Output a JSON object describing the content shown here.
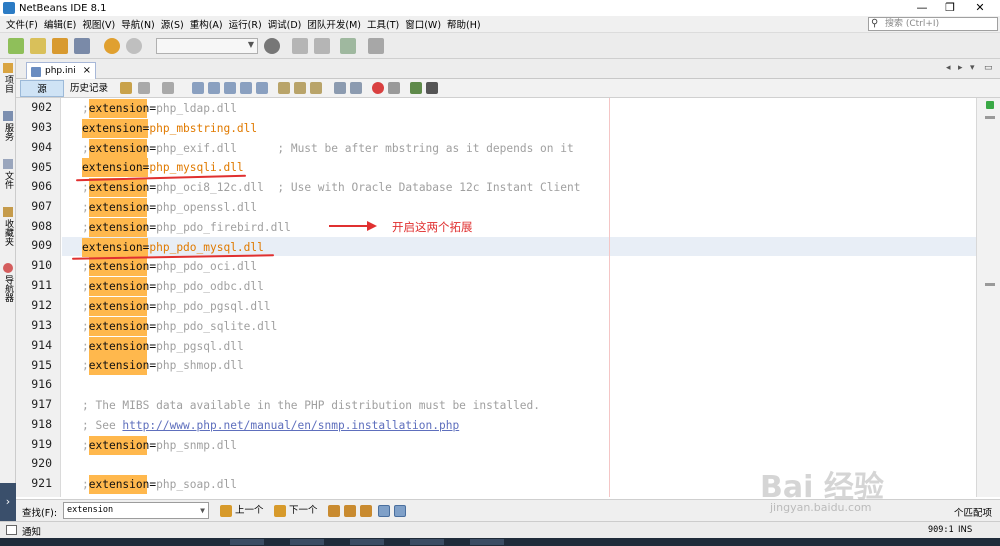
{
  "window": {
    "title": "NetBeans IDE 8.1",
    "minimize": "—",
    "restore": "❐",
    "close": "✕"
  },
  "menu": [
    "文件(F)",
    "编辑(E)",
    "视图(V)",
    "导航(N)",
    "源(S)",
    "重构(A)",
    "运行(R)",
    "调试(D)",
    "团队开发(M)",
    "工具(T)",
    "窗口(W)",
    "帮助(H)"
  ],
  "search": {
    "placeholder": "搜索 (Ctrl+I)",
    "icon": "magnifier-icon"
  },
  "side_tabs": [
    "项目",
    "服务",
    "文件",
    "收藏夹",
    "导航器"
  ],
  "editor_tab": {
    "name": "php.ini",
    "close": "×"
  },
  "editor_toolbar": {
    "source": "源",
    "history": "历史记录"
  },
  "lines": [
    {
      "n": "902",
      "pre": ";",
      "kw": "extension",
      "val": "php_ldap.dll",
      "cmt": "",
      "on": false
    },
    {
      "n": "903",
      "pre": "",
      "kw": "extension",
      "val": "php_mbstring.dll",
      "cmt": "",
      "on": true
    },
    {
      "n": "904",
      "pre": ";",
      "kw": "extension",
      "val": "php_exif.dll",
      "cmt": "      ; Must be after mbstring as it depends on it",
      "on": false
    },
    {
      "n": "905",
      "pre": "",
      "kw": "extension",
      "val": "php_mysqli.dll",
      "cmt": "",
      "on": true
    },
    {
      "n": "906",
      "pre": ";",
      "kw": "extension",
      "val": "php_oci8_12c.dll",
      "cmt": "  ; Use with Oracle Database 12c Instant Client",
      "on": false
    },
    {
      "n": "907",
      "pre": ";",
      "kw": "extension",
      "val": "php_openssl.dll",
      "cmt": "",
      "on": false
    },
    {
      "n": "908",
      "pre": ";",
      "kw": "extension",
      "val": "php_pdo_firebird.dll",
      "cmt": "",
      "on": false
    },
    {
      "n": "909",
      "pre": "",
      "kw": "extension",
      "val": "php_pdo_mysql.dll",
      "cmt": "",
      "on": true
    },
    {
      "n": "910",
      "pre": ";",
      "kw": "extension",
      "val": "php_pdo_oci.dll",
      "cmt": "",
      "on": false
    },
    {
      "n": "911",
      "pre": ";",
      "kw": "extension",
      "val": "php_pdo_odbc.dll",
      "cmt": "",
      "on": false
    },
    {
      "n": "912",
      "pre": ";",
      "kw": "extension",
      "val": "php_pdo_pgsql.dll",
      "cmt": "",
      "on": false
    },
    {
      "n": "913",
      "pre": ";",
      "kw": "extension",
      "val": "php_pdo_sqlite.dll",
      "cmt": "",
      "on": false
    },
    {
      "n": "914",
      "pre": ";",
      "kw": "extension",
      "val": "php_pgsql.dll",
      "cmt": "",
      "on": false
    },
    {
      "n": "915",
      "pre": ";",
      "kw": "extension",
      "val": "php_shmop.dll",
      "cmt": "",
      "on": false
    },
    {
      "n": "916",
      "pre": "",
      "kw": "",
      "val": "",
      "cmt": "",
      "on": false
    },
    {
      "n": "917",
      "pre": "",
      "kw": "",
      "val": "",
      "cmt": "; The MIBS data available in the PHP distribution must be installed.",
      "on": false
    },
    {
      "n": "918",
      "pre": "",
      "kw": "",
      "val": "",
      "cmt": "; See ",
      "link": "http://www.php.net/manual/en/snmp.installation.php",
      "on": false
    },
    {
      "n": "919",
      "pre": ";",
      "kw": "extension",
      "val": "php_snmp.dll",
      "cmt": "",
      "on": false
    },
    {
      "n": "920",
      "pre": "",
      "kw": "",
      "val": "",
      "cmt": "",
      "on": false
    },
    {
      "n": "921",
      "pre": ";",
      "kw": "extension",
      "val": "php_soap.dll",
      "cmt": "",
      "on": false
    }
  ],
  "annotation": "开启这两个拓展",
  "find": {
    "label": "查找(F):",
    "value": "extension",
    "prev": "上一个",
    "next": "下一个",
    "matches": "个匹配项"
  },
  "status": {
    "message": "通知",
    "position": "909:1",
    "mode": "INS"
  },
  "watermark": {
    "main": "Bai 经验",
    "sub": "jingyan.baidu.com"
  },
  "colors": {
    "highlight": "#ffb84d",
    "annotation": "#e03030",
    "current_line": "#e8eef6"
  }
}
